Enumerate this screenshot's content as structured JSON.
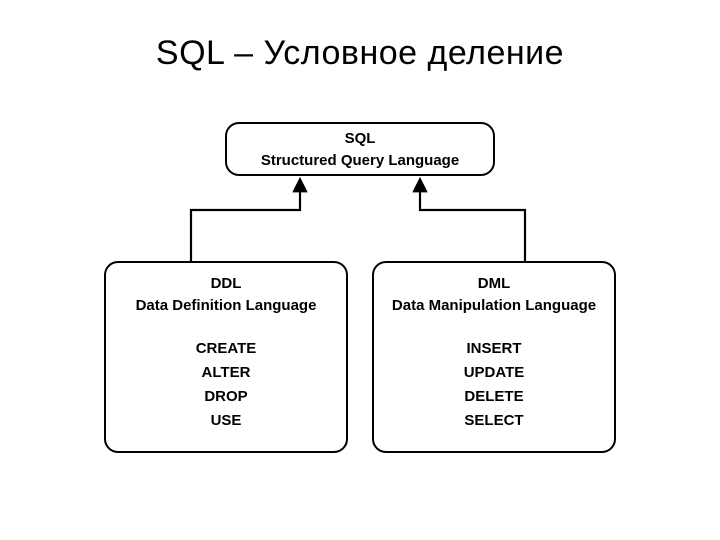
{
  "title": "SQL – Условное деление",
  "parent": {
    "line1": "SQL",
    "line2": "Structured Query Language"
  },
  "left": {
    "abbr": "DDL",
    "full": "Data Definition Language",
    "kw1": "CREATE",
    "kw2": "ALTER",
    "kw3": "DROP",
    "kw4": "USE"
  },
  "right": {
    "abbr": "DML",
    "full": "Data Manipulation Language",
    "kw1": "INSERT",
    "kw2": "UPDATE",
    "kw3": "DELETE",
    "kw4": "SELECT"
  }
}
